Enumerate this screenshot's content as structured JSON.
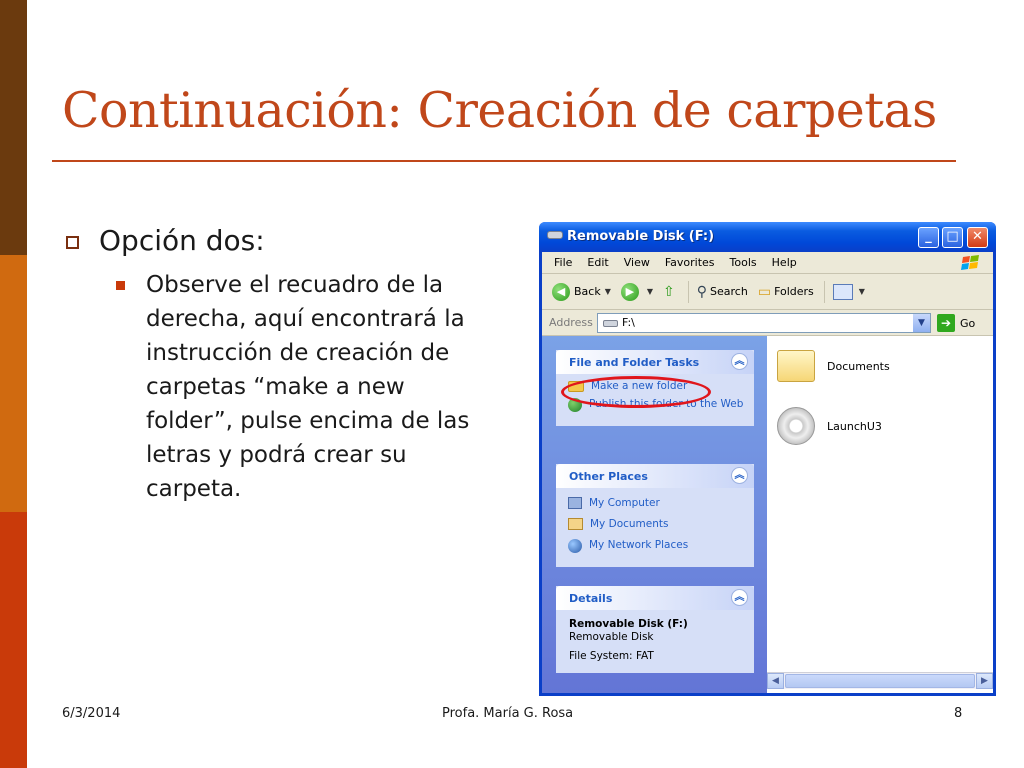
{
  "slide": {
    "title": "Continuación: Creación de carpetas",
    "bullet_level1": "Opción dos:",
    "bullet_level2": "Observe el recuadro de la derecha, aquí encontrará la instrucción de creación de carpetas “make a new folder”, pulse encima de las letras y podrá crear su carpeta.",
    "footer": {
      "date": "6/3/2014",
      "author": "Profa. María G. Rosa",
      "page": "8"
    }
  },
  "colors": {
    "accent": "#c0471a",
    "band_top": "#6b3a0e",
    "band_mid": "#d06a10",
    "band_bottom": "#c93a0a",
    "xp_blue": "#0a3fc8",
    "highlight_oval": "#e0161c"
  },
  "window": {
    "title": "Removable Disk (F:)",
    "menu": [
      "File",
      "Edit",
      "View",
      "Favorites",
      "Tools",
      "Help"
    ],
    "toolbar": {
      "back": "Back",
      "search": "Search",
      "folders": "Folders"
    },
    "address": {
      "label": "Address",
      "value": "F:\\",
      "go": "Go"
    },
    "panels": {
      "tasks": {
        "title": "File and Folder Tasks",
        "items": [
          "Make a new folder",
          "Publish this folder to the Web"
        ]
      },
      "other_places": {
        "title": "Other Places",
        "items": [
          "My Computer",
          "My Documents",
          "My Network Places"
        ]
      },
      "details": {
        "title": "Details",
        "name": "Removable Disk (F:)",
        "type": "Removable Disk",
        "fs": "File System: FAT"
      }
    },
    "files": [
      {
        "name": "Documents",
        "icon": "folder-icon"
      },
      {
        "name": "LaunchU3",
        "icon": "cd-icon"
      }
    ],
    "scroll_thumb_label": "III"
  }
}
